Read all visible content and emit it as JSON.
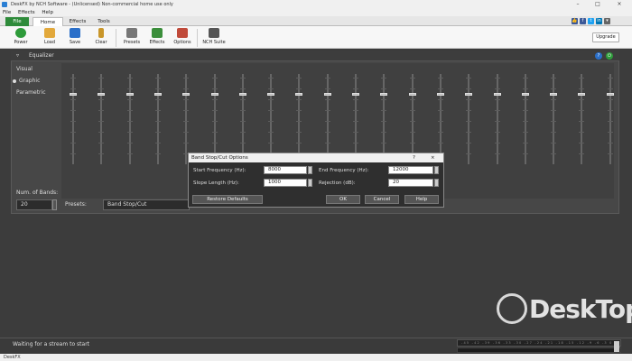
{
  "window": {
    "title": "DeskFX by NCH Software - (Unlicensed) Non-commercial home use only",
    "minimize": "–",
    "maximize": "□",
    "close": "×"
  },
  "menu": [
    "File",
    "Effects",
    "Help"
  ],
  "tabs": [
    {
      "label": "File"
    },
    {
      "label": "Home"
    },
    {
      "label": "Effects"
    },
    {
      "label": "Tools"
    }
  ],
  "social": [
    {
      "icon": "thumbs-up-icon",
      "glyph": "👍",
      "color": "#3b5998"
    },
    {
      "icon": "facebook-icon",
      "glyph": "f",
      "color": "#3b5998"
    },
    {
      "icon": "twitter-icon",
      "glyph": "t",
      "color": "#1da1f2"
    },
    {
      "icon": "linkedin-icon",
      "glyph": "in",
      "color": "#0077b5"
    },
    {
      "icon": "help-icon",
      "glyph": "▾",
      "color": "#666666"
    }
  ],
  "ribbon": [
    {
      "label": "Power",
      "icon": "power-icon",
      "color": "#2e9b3a"
    },
    {
      "label": "Load",
      "icon": "folder-open-icon",
      "color": "#e2a83b"
    },
    {
      "label": "Save",
      "icon": "save-icon",
      "color": "#2a6fc9"
    },
    {
      "label": "Clear",
      "icon": "broom-icon",
      "color": "#c9962a"
    },
    {
      "label": "Presets",
      "icon": "presets-icon",
      "color": "#777777"
    },
    {
      "label": "Effects",
      "icon": "effects-icon",
      "color": "#3b8e3b"
    },
    {
      "label": "Options",
      "icon": "options-icon",
      "color": "#c04a3a"
    },
    {
      "label": "NCH Suite",
      "icon": "nch-suite-icon",
      "color": "#555555"
    }
  ],
  "upgrade_label": "Upgrade",
  "equalizer": {
    "title": "Equalizer",
    "modes": [
      {
        "label": "Visual"
      },
      {
        "label": "Graphic"
      },
      {
        "label": "Parametric"
      }
    ],
    "num_bands_label": "Num. of Bands:",
    "num_bands_value": "20",
    "presets_label": "Presets:",
    "preset_value": "Band Stop/Cut"
  },
  "dialog": {
    "title": "Band Stop/Cut Options",
    "help_glyph": "?",
    "close_glyph": "×",
    "start_freq_label": "Start Frequency (Hz):",
    "start_freq_value": "8000",
    "end_freq_label": "End Frequency (Hz):",
    "end_freq_value": "12000",
    "slope_label": "Slope Length (Hz):",
    "slope_value": "1000",
    "rejection_label": "Rejection (dB):",
    "rejection_value": "20",
    "restore_label": "Restore Defaults",
    "ok_label": "OK",
    "cancel_label": "Cancel",
    "help_label": "Help"
  },
  "status": {
    "text": "Waiting for a stream to start",
    "meter_scale": "-45 -42 -39 -36 -33 -30 -27 -24 -21 -18 -15 -12 -9 -6 -3 0"
  },
  "bottom_label": "DeskFX",
  "watermark": "DeskTop"
}
